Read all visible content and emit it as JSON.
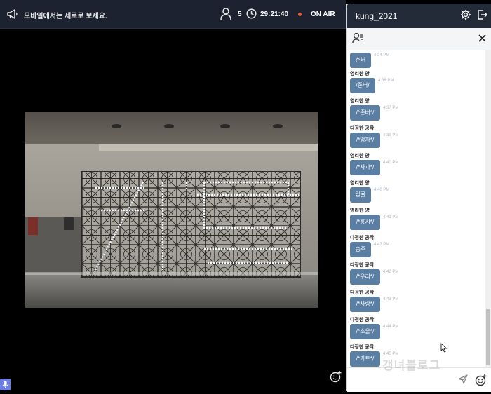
{
  "topbar": {
    "notice": "모바일에서는 세로로 보세요.",
    "viewer_count": "5",
    "time": "29:21:40",
    "onair_label": "ON AIR",
    "onair_color": "#f05a3c",
    "icons": [
      "megaphone-icon",
      "person-icon",
      "clock-icon"
    ]
  },
  "panel": {
    "title": "kung_2021",
    "icons": [
      "gear-icon",
      "exit-icon",
      "user-list-icon",
      "close-icon",
      "send-icon",
      "emoji-icon"
    ],
    "input_value": "",
    "bubble_color": "#5b7ea3"
  },
  "messages": [
    {
      "nick": "",
      "text": "존버",
      "time": "4:34 PM"
    },
    {
      "nick": "영리한 양",
      "text": "/존버/",
      "time": "4:36 PM"
    },
    {
      "nick": "영리한 양",
      "text": "/*존버*/",
      "time": "4:37 PM"
    },
    {
      "nick": "다정한 공작",
      "text": "/*엉차*/",
      "time": "4:39 PM"
    },
    {
      "nick": "영리한 양",
      "text": "/*사과*/",
      "time": "4:40 PM"
    },
    {
      "nick": "영리한 양",
      "text": "감귤",
      "time": "4:40 PM"
    },
    {
      "nick": "영리한 양",
      "text": "/*홍시*/",
      "time": "4:41 PM"
    },
    {
      "nick": "다정한 공작",
      "text": "승주",
      "time": "4:42 PM"
    },
    {
      "nick": "다정한 공작",
      "text": "/*우리*/",
      "time": "4:42 PM"
    },
    {
      "nick": "다정한 공작",
      "text": "/*사랑*/",
      "time": "4:43 PM"
    },
    {
      "nick": "다정한 공작",
      "text": "/*소울*/",
      "time": "4:44 PM"
    },
    {
      "nick": "다정한 공작",
      "text": "/*카트*/",
      "time": "4:45 PM"
    }
  ],
  "watermark": "갱녀블로그"
}
